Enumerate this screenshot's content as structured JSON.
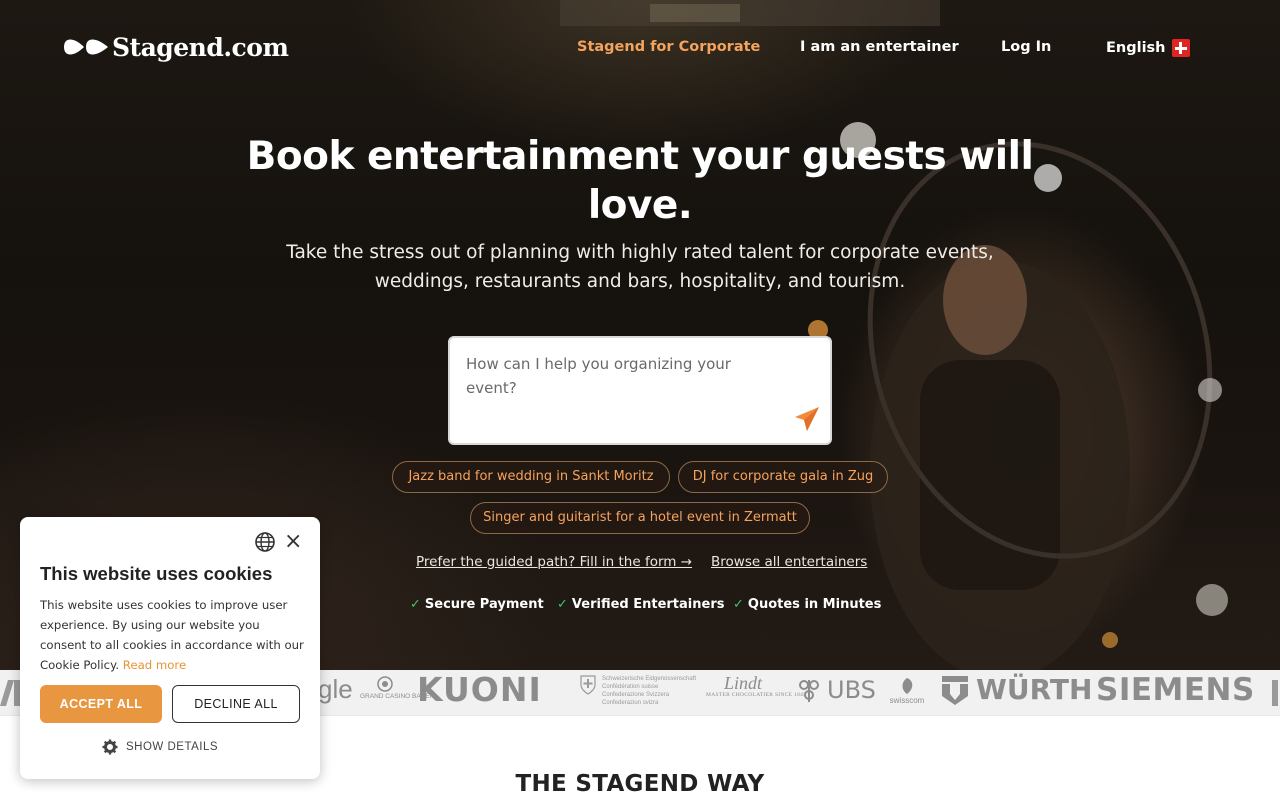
{
  "brand": {
    "name": "Stagend.com",
    "accent_color": "#f5a35c",
    "logo_icon": "double-play-icon"
  },
  "nav": {
    "corporate": "Stagend for Corporate",
    "entertainer": "I am an entertainer",
    "login": "Log In",
    "language": "English",
    "language_flag_icon": "swiss-flag-icon"
  },
  "hero": {
    "headline": "Book entertainment your guests will love.",
    "subheadline": "Take the stress out of planning with highly rated talent for corporate events, weddings, restaurants and bars, hospitality, and tourism.",
    "search_placeholder": "How can I help you organizing your event?",
    "send_icon": "paper-plane-icon",
    "chips": [
      "Jazz band for wedding in Sankt Moritz",
      "DJ for corporate gala in Zug",
      "Singer and guitarist for a hotel event in Zermatt"
    ],
    "guided_link": "Prefer the guided path? Fill in the form →",
    "browse_link": "Browse all entertainers",
    "trust": [
      "Secure Payment",
      "Verified Entertainers",
      "Quotes in Minutes"
    ],
    "check_symbol": "✓"
  },
  "logos": {
    "google": "gle",
    "casino": "GRAND CASINO BADEN",
    "kuoni": "KUONI",
    "confed_lines": [
      "Schweizerische Eidgenossenschaft",
      "Confédération suisse",
      "Confederazione Svizzera",
      "Confederaziun svizra"
    ],
    "lindt": "Lindt",
    "lindt_sub": "MASTER CHOCOLATIER SINCE 1845",
    "ubs": "UBS",
    "swisscom": "swisscom",
    "wurth": "WÜRTH",
    "siemens": "SIEMENS"
  },
  "section_title": "THE STAGEND WAY",
  "cookie": {
    "title": "This website uses cookies",
    "body": "This website uses cookies to improve user experience. By using our website you consent to all cookies in accordance with our Cookie Policy.",
    "read_more": "Read more",
    "accept": "ACCEPT ALL",
    "decline": "DECLINE ALL",
    "details": "SHOW DETAILS",
    "close_symbol": "×",
    "accept_color": "#e89640"
  }
}
